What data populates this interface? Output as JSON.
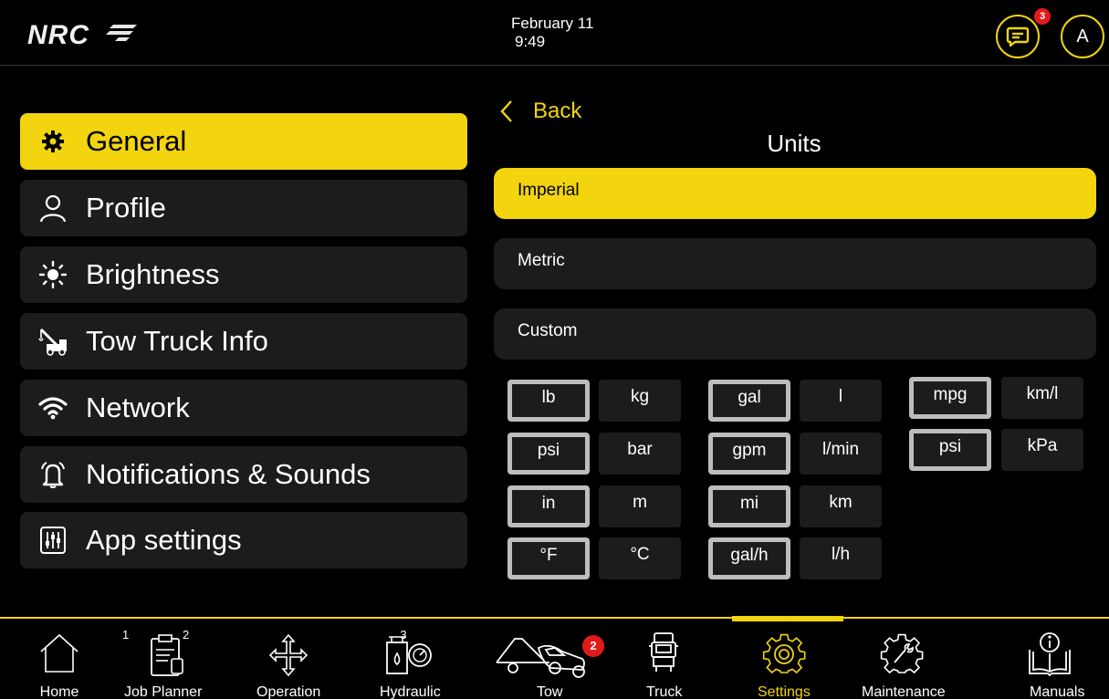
{
  "header": {
    "logo": "NRC",
    "date": "February 11",
    "time": "9:49",
    "message_count": "3",
    "avatar_initial": "A"
  },
  "menu": {
    "items": [
      {
        "label": "General",
        "icon": "gear-icon",
        "active": true
      },
      {
        "label": "Profile",
        "icon": "user-icon",
        "active": false
      },
      {
        "label": "Brightness",
        "icon": "sun-icon",
        "active": false
      },
      {
        "label": "Tow Truck Info",
        "icon": "tow-truck-icon",
        "active": false
      },
      {
        "label": "Network",
        "icon": "wifi-icon",
        "active": false
      },
      {
        "label": "Notifications & Sounds",
        "icon": "bell-icon",
        "active": false
      },
      {
        "label": "App settings",
        "icon": "sliders-icon",
        "active": false
      }
    ]
  },
  "units": {
    "back_label": "Back",
    "title": "Units",
    "options": [
      "Imperial",
      "Metric",
      "Custom"
    ],
    "selected_option": "Imperial",
    "pairs": [
      {
        "a": "lb",
        "b": "kg",
        "selected": "a"
      },
      {
        "a": "psi",
        "b": "bar",
        "selected": "a"
      },
      {
        "a": "in",
        "b": "m",
        "selected": "a"
      },
      {
        "a": "°F",
        "b": "°C",
        "selected": "a"
      },
      {
        "a": "gal",
        "b": "l",
        "selected": "a"
      },
      {
        "a": "gpm",
        "b": "l/min",
        "selected": "a"
      },
      {
        "a": "mi",
        "b": "km",
        "selected": "a"
      },
      {
        "a": "gal/h",
        "b": "l/h",
        "selected": "a"
      },
      {
        "a": "mpg",
        "b": "km/l",
        "selected": "a"
      },
      {
        "a": "psi",
        "b": "kPa",
        "selected": "a"
      }
    ]
  },
  "nav": {
    "items": [
      {
        "label": "Home",
        "num": "",
        "icon": "home-icon"
      },
      {
        "label": "Job Planner",
        "num": "1",
        "icon": "clipboard-icon"
      },
      {
        "label": "Operation",
        "num": "2",
        "icon": "move-arrows-icon"
      },
      {
        "label": "Hydraulic",
        "num": "3",
        "icon": "hydraulic-gauge-icon"
      },
      {
        "label": "Tow",
        "num": "",
        "icon": "tow-icon",
        "badge": "2"
      },
      {
        "label": "Truck",
        "num": "",
        "icon": "truck-icon"
      },
      {
        "label": "Settings",
        "num": "",
        "icon": "settings-gear-icon",
        "active": true
      },
      {
        "label": "Maintenance",
        "num": "",
        "icon": "wrench-gear-icon"
      },
      {
        "label": "Manuals",
        "num": "",
        "icon": "manual-book-icon"
      }
    ]
  },
  "colors": {
    "accent": "#f2d40f",
    "badge": "#e21a1a",
    "panel": "#1c1c1c",
    "background": "#000000"
  }
}
